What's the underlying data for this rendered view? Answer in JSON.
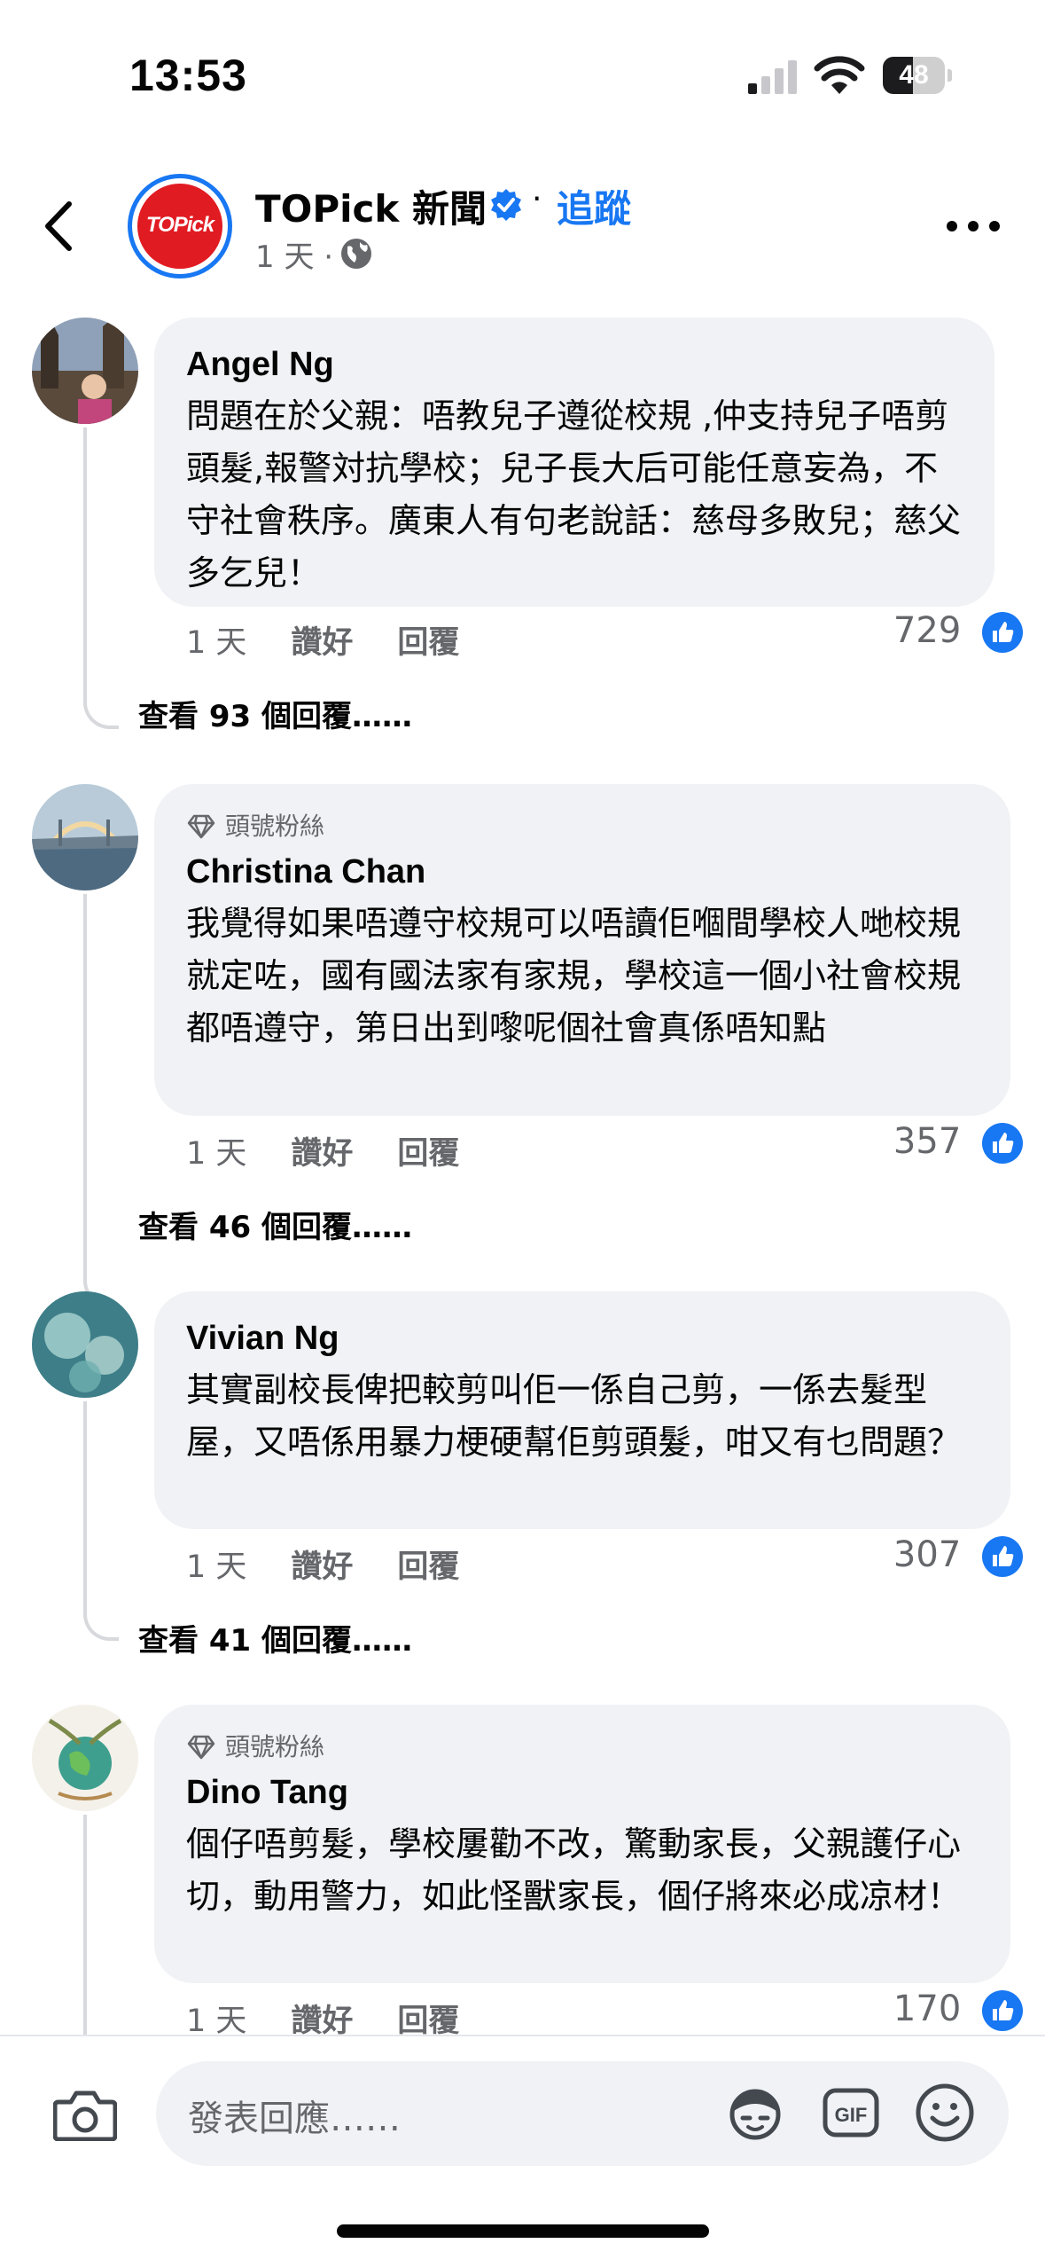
{
  "status": {
    "time": "13:53",
    "battery": "48",
    "battery_level": 0.48
  },
  "header": {
    "page_name": "TOPick 新聞",
    "dot": "·",
    "follow": "追蹤",
    "age": "1 天 ·",
    "logo_text": "TOPick"
  },
  "comments": [
    {
      "author": "Angel Ng",
      "badge": "",
      "text": "問題在於父親：唔教兒子遵從校規 ,仲支持兒子唔剪頭髮,報警対抗學校；兒子長大后可能任意妄為，不守社會秩序。廣東人有句老說話：慈母多敗兒；慈父多乞兒！",
      "time": "1 天",
      "like": "讚好",
      "reply": "回覆",
      "likes": "729",
      "view_replies": "查看 93 個回覆……"
    },
    {
      "author": "Christina Chan",
      "badge": "頭號粉絲",
      "text": "我覺得如果唔遵守校規可以唔讀佢嗰間學校人哋校規就定咗，國有國法家有家規，學校這一個小社會校規都唔遵守，第日出到嚟呢個社會真係唔知點",
      "time": "1 天",
      "like": "讚好",
      "reply": "回覆",
      "likes": "357",
      "view_replies": "查看 46 個回覆……"
    },
    {
      "author": "Vivian Ng",
      "badge": "",
      "text": "其實副校長俾把較剪叫佢一係自己剪，一係去髮型屋，又唔係用暴力梗硬幫佢剪頭髮，咁又有乜問題？",
      "time": "1 天",
      "like": "讚好",
      "reply": "回覆",
      "likes": "307",
      "view_replies": "查看 41 個回覆……"
    },
    {
      "author": "Dino Tang",
      "badge": "頭號粉絲",
      "text": "個仔唔剪髮，學校屢勸不改，驚動家長，父親護仔心切，動用警力，如此怪獸家長，個仔將來必成凉材！",
      "time": "1 天",
      "like": "讚好",
      "reply": "回覆",
      "likes": "170",
      "view_replies": ""
    }
  ],
  "composer": {
    "placeholder": "發表回應……",
    "gif": "GIF"
  },
  "colors": {
    "accent": "#1877f2",
    "bubble": "#f0f2f5",
    "secondary_text": "#65676b",
    "brand_red": "#e11b22"
  }
}
